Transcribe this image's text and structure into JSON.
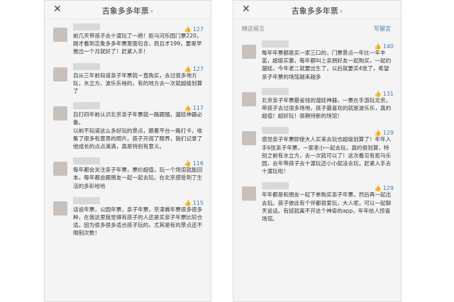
{
  "left": {
    "title": "吉象多多年票",
    "title_chevron": "›",
    "close_label": "✕",
    "comments": [
      {
        "likes": "127",
        "text": "前几天带孩子去十渡玩了一趟！拒马河乐园门票220，刚才看到吉象多多年票里面包含，而且才199，要是早推出一个月就好了！赶紧入手！"
      },
      {
        "likes": "127",
        "text": "自从三年前知道亲子年票就一直购买，去过很多地方玩，水立方、波乐乐啥的，有的地方去一次就超级划算了"
      },
      {
        "likes": "117",
        "text": "自打四年前认识北京亲子年票就一路跟随，遛娃神器必备。\n以前不知道这么多好玩的景点，跟着平台一路打卡，收集了很多有意思的照片。孩子开阔了眼界，我们记录了他成长的点点滴滴，真是特别有意义。"
      },
      {
        "likes": "116",
        "text": "每年都会关注亲子年票，票价超值，玩一个场馆就能回本，每年都会跟朋友一起一起去玩，在北京感受到了生活的多彩哈哈"
      },
      {
        "likes": "115",
        "text": "话说年票，公园年票，亲子年票，京津冀年票很多很多种，在我这里我觉得有孩子的人还是买亲子年票比较合适，因为很多很多适合孩子玩的，尤其是有的景点还不限制次数！"
      }
    ]
  },
  "right": {
    "title": "吉象多多年票",
    "title_chevron": "›",
    "close_label": "✕",
    "section_label": "精选留言",
    "write_label": "写留言",
    "comments": [
      {
        "likes": "140",
        "text": "每年年票都是买一家三口的，门票景点一年比一年丰富，超级实惠，每年都叫上亲朋好友一起购买，一起约遛娃，今年老二就要出生了，以后就要买4张了，希望亲子年票的场馆越来越多"
      },
      {
        "likes": "131",
        "text": "北京亲子年票最省钱的溜娃神器，一票在手游玩北京。带孩子去过很多场地，孩子最喜欢的就是波乐乐，真的超值！超好玩！很期待新的场馆！"
      },
      {
        "likes": "129",
        "text": "感觉亲子年票即使大人买来去玩也超级划算了！年年入手6张亲子年票，一家老小一起去玩，真的很划算，特别之前有水立方，去一次就可以了！这次看见有拒马乐园，去年带孩子去十渡玩还小小就没去玩，赶紧入手去十渡玩啦！"
      },
      {
        "likes": "129",
        "text": "年年都是和朋友一起下单购买亲子年票，然后再一起出去玩。孩子彼此有个伴都很爱玩，大人呢，可以一起聊天说话。有娃就离不开这个神奇的app，年年给人惊喜场馆。"
      }
    ]
  },
  "colors": {
    "link": "#4a78b0",
    "avatar": "#c8c0bb"
  }
}
